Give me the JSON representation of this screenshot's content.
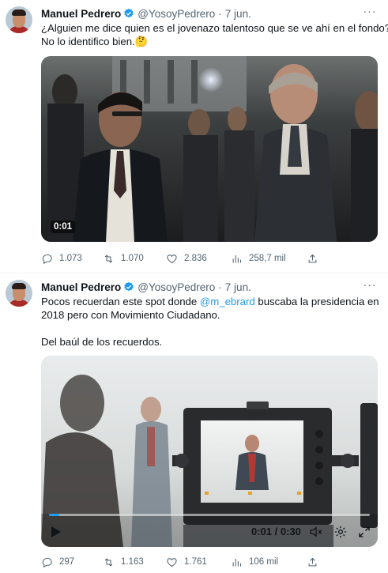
{
  "tweets": [
    {
      "author_name": "Manuel Pedrero",
      "handle": "@YosoyPedrero",
      "separator": "·",
      "date": "7 jun.",
      "more_label": "···",
      "text_lines": [
        "¿Alguien me dice quien es el jovenazo talentoso que se ve ahí en el fondo?",
        "No lo identifico bien.🤔"
      ],
      "video": {
        "timestamp": "0:01"
      },
      "metrics": {
        "replies": "1.073",
        "retweets": "1.070",
        "likes": "2.836",
        "views": "258,7 mil"
      }
    },
    {
      "author_name": "Manuel Pedrero",
      "handle": "@YosoyPedrero",
      "separator": "·",
      "date": "7 jun.",
      "more_label": "···",
      "text_line1_before": "Pocos recuerdan este spot donde ",
      "mention": "@m_ebrard",
      "text_line1_after": " buscaba la presidencia en",
      "text_line2": "2018 pero con Movimiento Ciudadano.",
      "text_line3": "Del baúl de los recuerdos.",
      "video": {
        "time": "0:01 / 0:30",
        "progress": 0.033
      },
      "metrics": {
        "replies": "297",
        "retweets": "1.163",
        "likes": "1.761",
        "views": "106 mil"
      }
    }
  ],
  "colors": {
    "accent": "#1d9bf0",
    "secondary_text": "#536471",
    "primary_text": "#0f1419",
    "divider": "#eff3f4"
  },
  "icons": [
    "verified-badge-icon",
    "more-options-icon",
    "reply-icon",
    "retweet-icon",
    "like-icon",
    "views-icon",
    "share-icon",
    "play-icon",
    "volume-icon",
    "settings-icon",
    "fullscreen-icon"
  ]
}
